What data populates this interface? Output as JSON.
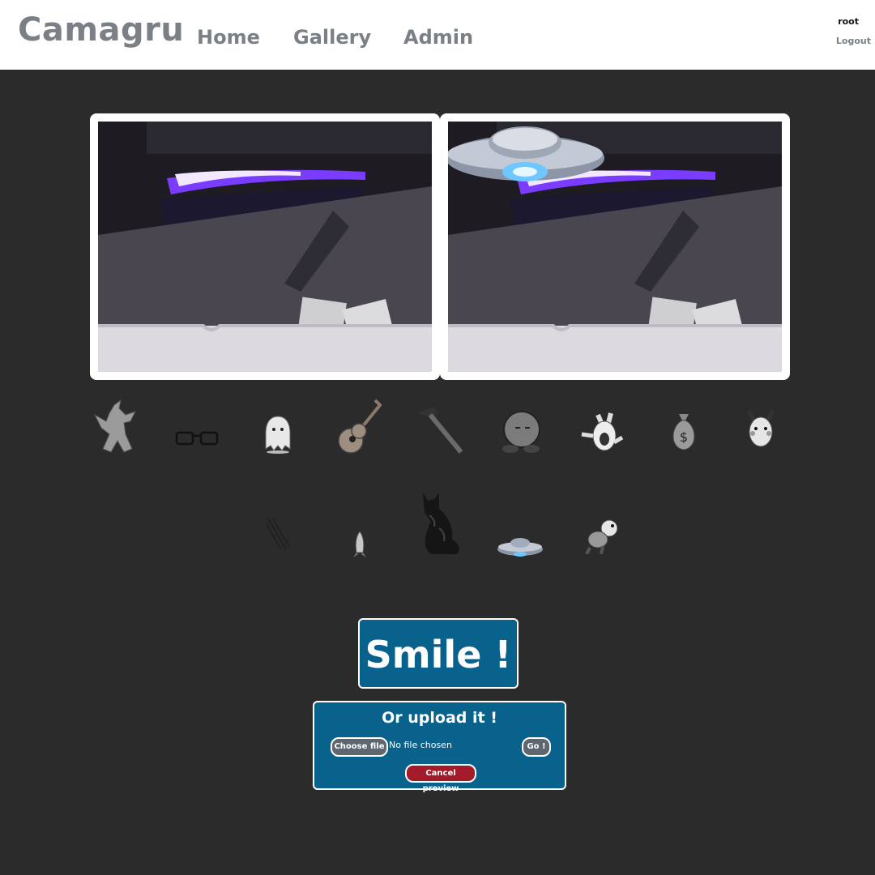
{
  "header": {
    "brand": "Camagru",
    "nav": [
      "Home",
      "Gallery",
      "Admin"
    ],
    "user": "root",
    "logout": "Logout"
  },
  "stickers": {
    "row1": [
      "dragon-icon",
      "glasses-icon",
      "ghost-icon",
      "guitar-icon",
      "hammer-icon",
      "kirby-icon",
      "rabbid-icon",
      "money-bag-icon",
      "pikachu-icon"
    ],
    "row2": [
      "claw-marks-icon",
      "rocket-icon",
      "cat-icon",
      "ufo-icon",
      "yoshi-icon"
    ]
  },
  "actions": {
    "smile": "Smile !",
    "upload_title": "Or upload it !",
    "choose_file": "Choose file",
    "file_status": "No file chosen",
    "go": "Go !",
    "cancel_preview": "Cancel preview"
  },
  "colors": {
    "background": "#2b2b2b",
    "button_blue": "#08628c",
    "button_red": "#a31a2b",
    "nav_gray": "#7b7f86"
  }
}
